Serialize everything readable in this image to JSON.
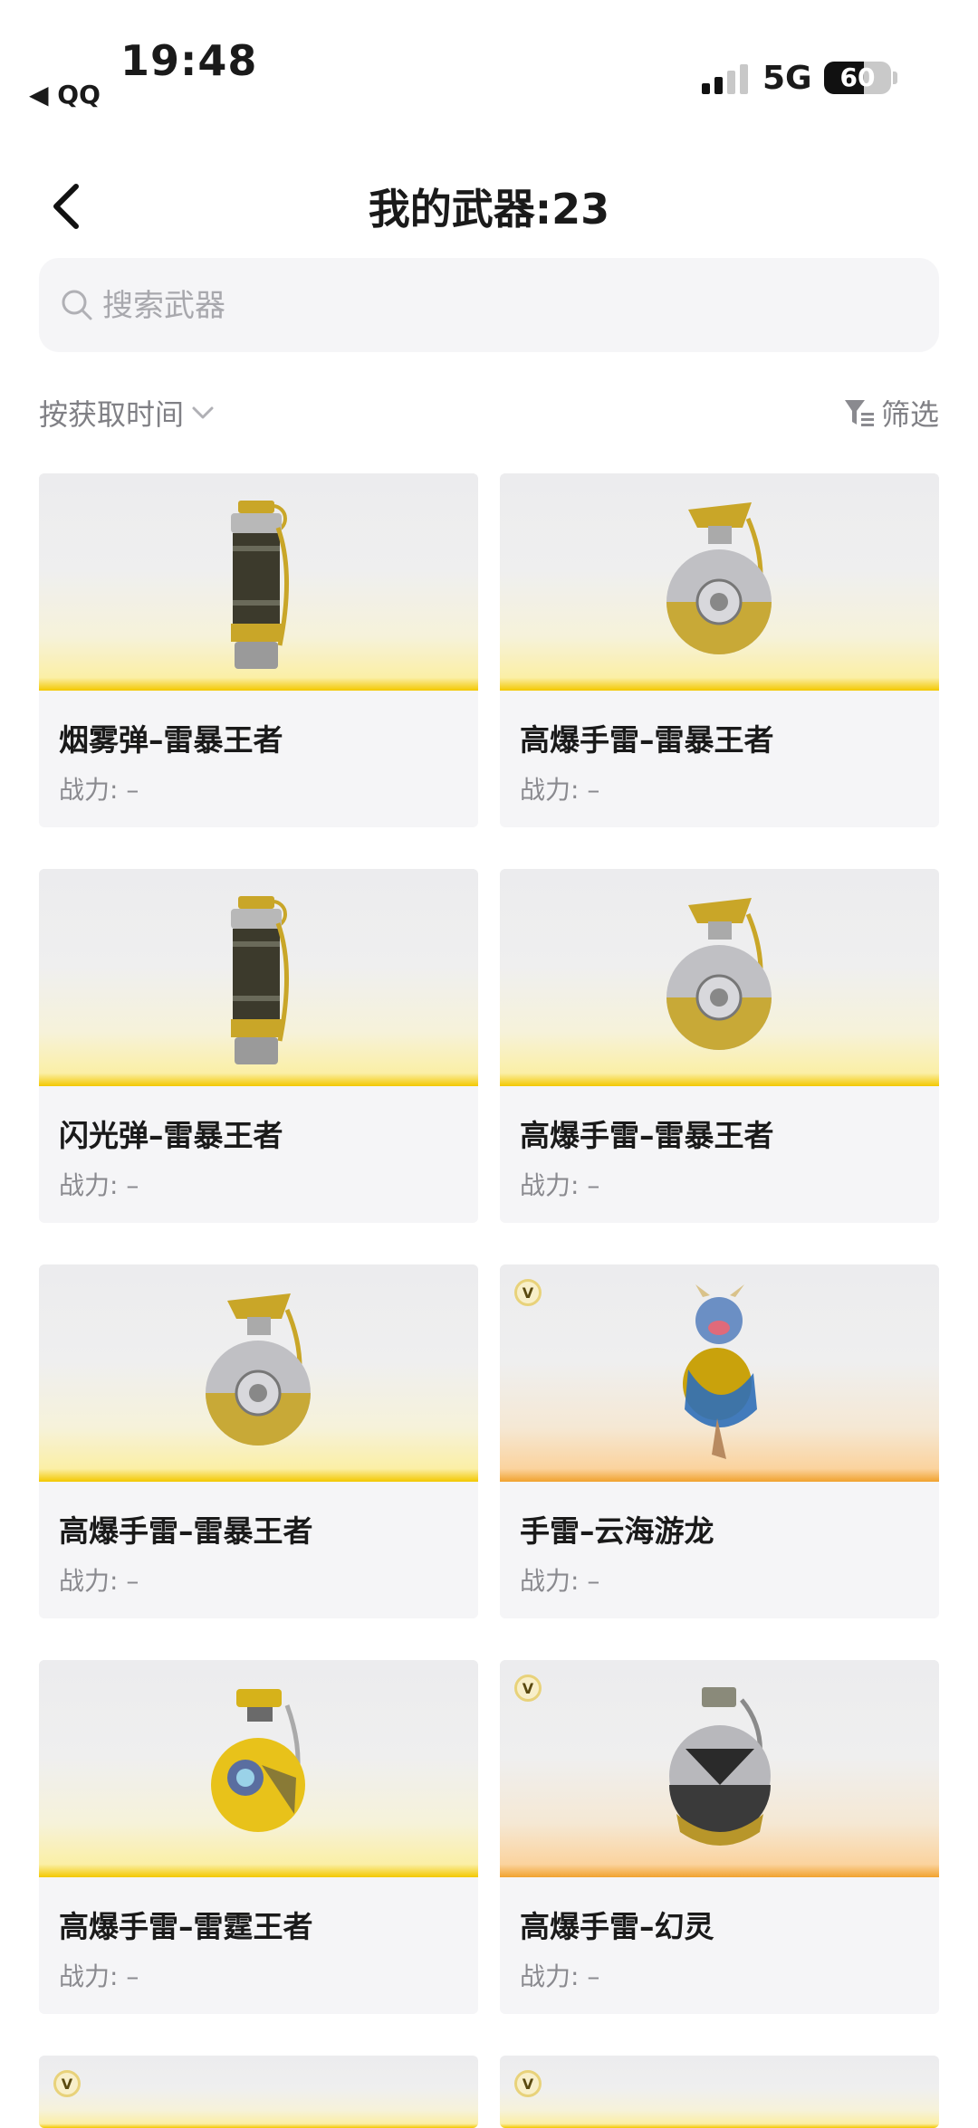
{
  "status_bar": {
    "time": "19:48",
    "back_app": "◀ QQ",
    "network": "5G",
    "battery": "60",
    "battery_level": 0.6
  },
  "header": {
    "title": "我的武器:23",
    "back_icon": "chevron-left-icon"
  },
  "search": {
    "placeholder": "搜索武器",
    "icon": "search-icon"
  },
  "toolbar": {
    "sort_label": "按获取时间",
    "filter_label": "筛选"
  },
  "weapons": [
    {
      "name": "烟雾弹–雷暴王者",
      "power_label": "战力:",
      "power_value": "–",
      "type": "canister",
      "tier": "yellow"
    },
    {
      "name": "高爆手雷–雷暴王者",
      "power_label": "战力:",
      "power_value": "–",
      "type": "sphere",
      "tier": "yellow"
    },
    {
      "name": "闪光弹–雷暴王者",
      "power_label": "战力:",
      "power_value": "–",
      "type": "canister",
      "tier": "yellow"
    },
    {
      "name": "高爆手雷–雷暴王者",
      "power_label": "战力:",
      "power_value": "–",
      "type": "sphere",
      "tier": "yellow"
    },
    {
      "name": "高爆手雷–雷暴王者",
      "power_label": "战力:",
      "power_value": "–",
      "type": "sphere",
      "tier": "yellow"
    },
    {
      "name": "手雷–云海游龙",
      "power_label": "战力:",
      "power_value": "–",
      "type": "dragon",
      "tier": "orange",
      "badge": "V"
    },
    {
      "name": "高爆手雷–雷霆王者",
      "power_label": "战力:",
      "power_value": "–",
      "type": "yellowball",
      "tier": "yellow"
    },
    {
      "name": "高爆手雷–幻灵",
      "power_label": "战力:",
      "power_value": "–",
      "type": "silverball",
      "tier": "orange",
      "badge": "V"
    }
  ],
  "partial_cards": [
    {
      "badge": "V"
    },
    {
      "badge": "V"
    }
  ]
}
